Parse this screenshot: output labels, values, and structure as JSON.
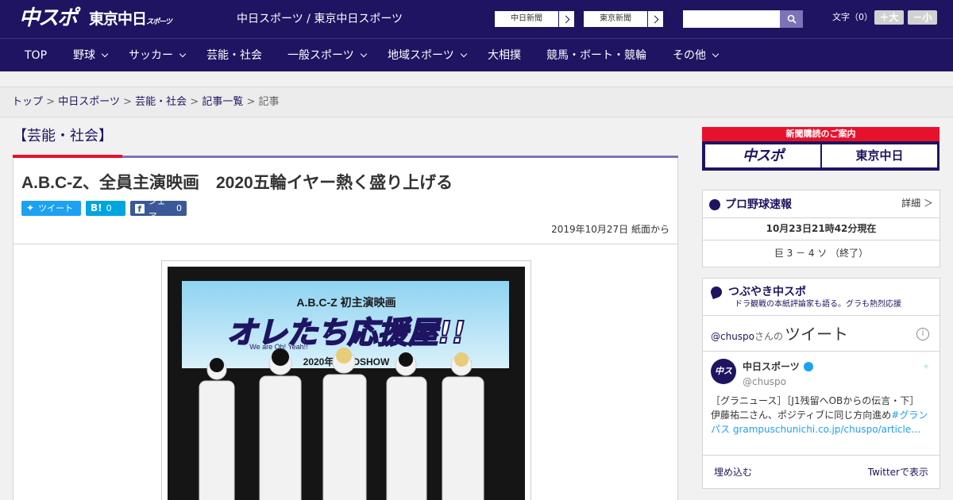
{
  "header": {
    "logo_main": "中スポ",
    "logo_tokyo": "東京中日",
    "logo_tokyo_small": "スポーツ",
    "site_name": "中日スポーツ / 東京中日スポーツ",
    "ext_links": [
      "中日新聞",
      "東京新聞"
    ],
    "search_placeholder": "",
    "font_size_label": "文字（0）",
    "font_plus": "＋大",
    "font_minus": "－小"
  },
  "nav": {
    "items": [
      {
        "label": "TOP",
        "dropdown": false
      },
      {
        "label": "野球",
        "dropdown": true
      },
      {
        "label": "サッカー",
        "dropdown": true
      },
      {
        "label": "芸能・社会",
        "dropdown": false
      },
      {
        "label": "一般スポーツ",
        "dropdown": true
      },
      {
        "label": "地域スポーツ",
        "dropdown": true
      },
      {
        "label": "大相撲",
        "dropdown": false
      },
      {
        "label": "競馬・ボート・競輪",
        "dropdown": false
      },
      {
        "label": "その他",
        "dropdown": true
      }
    ]
  },
  "breadcrumb": {
    "items": [
      "トップ",
      "中日スポーツ",
      "芸能・社会",
      "記事一覧"
    ],
    "current": "記事",
    "sep": ">"
  },
  "section": {
    "title": "【芸能・社会】"
  },
  "article": {
    "title": "A.B.C-Z、全員主演映画　2020五輪イヤー熱く盛り上げる",
    "share_twitter": "ツイート",
    "share_hatena_icon": "B!",
    "share_hatena_count": "0",
    "share_facebook": "シェア",
    "share_facebook_count": "0",
    "date": "2019年10月27日 紙面から",
    "photo_banner_top": "A.B.C-Z 初主演映画",
    "photo_banner_title": "オレたち応援屋!!",
    "photo_banner_sub": "We are Oh! Yeah!!",
    "photo_banner_bottom": "2020年　　DSHOW"
  },
  "sidebar": {
    "ad_title": "新聞購読のご案内",
    "ad_chuspo": "中スポ",
    "ad_tokyo": "東京中日",
    "baseball": {
      "title": "プロ野球速報",
      "more": "詳細 ＞",
      "time": "10月23日21時42分現在",
      "score": "巨 3 － 4 ソ （終了）"
    },
    "tweets": {
      "title": "つぶやき中スポ",
      "subtitle": "ドラ観戦の本紙評論家も語る。グラも熱烈応援",
      "handle_head": "@chuspo",
      "handle_mid": "さんの",
      "tweet_word": "ツイート",
      "account_name": "中日スポーツ",
      "account_handle": "@chuspo",
      "avatar_text": "中スポ",
      "tweet_line1": "［グラニュース］［J1残留へOBからの伝言・下］",
      "tweet_line2_plain": "伊藤祐二さん、ポジティブに同じ方向進め",
      "tweet_line2_link": "#グラン",
      "tweet_line3_link": "パス grampuschunichi.co.jp/chuspo/article…",
      "embed": "埋め込む",
      "view_on_twitter": "Twitterで表示"
    }
  },
  "colors": {
    "brand": "#1f1462",
    "accent_red": "#e8112d",
    "accent_purple": "#7c73b8"
  }
}
